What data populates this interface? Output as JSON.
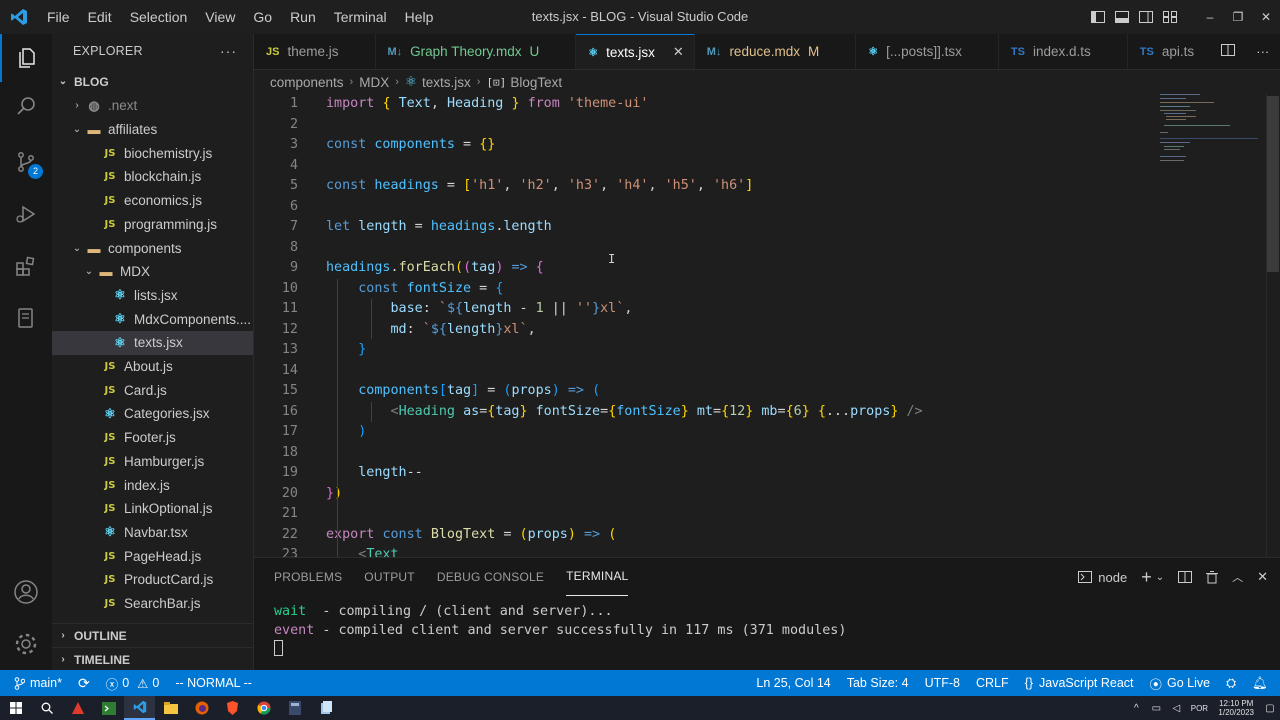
{
  "titlebar": {
    "menu": [
      "File",
      "Edit",
      "Selection",
      "View",
      "Go",
      "Run",
      "Terminal",
      "Help"
    ],
    "window_title": "texts.jsx - BLOG - Visual Studio Code"
  },
  "activity": {
    "source_control_badge": "2"
  },
  "explorer": {
    "header": "EXPLORER",
    "more": "···",
    "root": "BLOG",
    "rows": [
      {
        "label": ".next",
        "kind": "folder-next",
        "depth": 1,
        "chev": "›",
        "dim": true
      },
      {
        "label": "affiliates",
        "kind": "folder",
        "depth": 1,
        "chev": "⌄"
      },
      {
        "label": "biochemistry.js",
        "kind": "js",
        "depth": 2
      },
      {
        "label": "blockchain.js",
        "kind": "js",
        "depth": 2
      },
      {
        "label": "economics.js",
        "kind": "js",
        "depth": 2
      },
      {
        "label": "programming.js",
        "kind": "js",
        "depth": 2
      },
      {
        "label": "components",
        "kind": "folder",
        "depth": 1,
        "chev": "⌄"
      },
      {
        "label": "MDX",
        "kind": "folder",
        "depth": 2,
        "chev": "⌄"
      },
      {
        "label": "lists.jsx",
        "kind": "react",
        "depth": 3
      },
      {
        "label": "MdxComponents....",
        "kind": "react",
        "depth": 3
      },
      {
        "label": "texts.jsx",
        "kind": "react",
        "depth": 3,
        "selected": true
      },
      {
        "label": "About.js",
        "kind": "js",
        "depth": 2
      },
      {
        "label": "Card.js",
        "kind": "js",
        "depth": 2
      },
      {
        "label": "Categories.jsx",
        "kind": "react",
        "depth": 2
      },
      {
        "label": "Footer.js",
        "kind": "js",
        "depth": 2
      },
      {
        "label": "Hamburger.js",
        "kind": "js",
        "depth": 2
      },
      {
        "label": "index.js",
        "kind": "js",
        "depth": 2
      },
      {
        "label": "LinkOptional.js",
        "kind": "js",
        "depth": 2
      },
      {
        "label": "Navbar.tsx",
        "kind": "react",
        "depth": 2
      },
      {
        "label": "PageHead.js",
        "kind": "js",
        "depth": 2
      },
      {
        "label": "ProductCard.js",
        "kind": "js",
        "depth": 2
      },
      {
        "label": "SearchBar.js",
        "kind": "js",
        "depth": 2
      }
    ],
    "outline": "OUTLINE",
    "timeline": "TIMELINE"
  },
  "tabs": [
    {
      "label": "theme.js",
      "icon": "JS",
      "kind": "js"
    },
    {
      "label": "Graph Theory.mdx",
      "icon": "M↓",
      "kind": "mdx",
      "mod": "U",
      "mod_color": "#73c991"
    },
    {
      "label": "texts.jsx",
      "icon": "⚛",
      "kind": "react",
      "active": true,
      "close": "✕"
    },
    {
      "label": "reduce.mdx",
      "icon": "M↓",
      "kind": "mdx",
      "mod": "M",
      "mod_color": "#e2c08d"
    },
    {
      "label": "[...posts]].tsx",
      "icon": "⚛",
      "kind": "react"
    },
    {
      "label": "index.d.ts",
      "icon": "TS",
      "kind": "ts"
    },
    {
      "label": "api.ts",
      "icon": "TS",
      "kind": "ts"
    }
  ],
  "breadcrumb": {
    "items": [
      "components",
      "MDX",
      "texts.jsx",
      "BlogText"
    ]
  },
  "code": {
    "lines": [
      [
        [
          "kw-ctl",
          "import"
        ],
        [
          "pun",
          " "
        ],
        [
          "br1",
          "{"
        ],
        [
          "pun",
          " "
        ],
        [
          "var",
          "Text"
        ],
        [
          "pun",
          ", "
        ],
        [
          "var",
          "Heading"
        ],
        [
          "pun",
          " "
        ],
        [
          "br1",
          "}"
        ],
        [
          "pun",
          " "
        ],
        [
          "ctl",
          "from"
        ],
        [
          "pun",
          " "
        ],
        [
          "str",
          "'theme-ui'"
        ]
      ],
      [],
      [
        [
          "kw",
          "const"
        ],
        [
          "pun",
          " "
        ],
        [
          "const",
          "components"
        ],
        [
          "pun",
          " = "
        ],
        [
          "br1",
          "{}"
        ]
      ],
      [],
      [
        [
          "kw",
          "const"
        ],
        [
          "pun",
          " "
        ],
        [
          "const",
          "headings"
        ],
        [
          "pun",
          " = "
        ],
        [
          "br1",
          "["
        ],
        [
          "str",
          "'h1'"
        ],
        [
          "pun",
          ", "
        ],
        [
          "str",
          "'h2'"
        ],
        [
          "pun",
          ", "
        ],
        [
          "str",
          "'h3'"
        ],
        [
          "pun",
          ", "
        ],
        [
          "str",
          "'h4'"
        ],
        [
          "pun",
          ", "
        ],
        [
          "str",
          "'h5'"
        ],
        [
          "pun",
          ", "
        ],
        [
          "str",
          "'h6'"
        ],
        [
          "br1",
          "]"
        ]
      ],
      [],
      [
        [
          "kw",
          "let"
        ],
        [
          "pun",
          " "
        ],
        [
          "var",
          "length"
        ],
        [
          "pun",
          " = "
        ],
        [
          "const",
          "headings"
        ],
        [
          "pun",
          "."
        ],
        [
          "var",
          "length"
        ]
      ],
      [],
      [
        [
          "const",
          "headings"
        ],
        [
          "pun",
          "."
        ],
        [
          "fn",
          "forEach"
        ],
        [
          "br1",
          "("
        ],
        [
          "br2",
          "("
        ],
        [
          "var",
          "tag"
        ],
        [
          "br2",
          ")"
        ],
        [
          "pun",
          " "
        ],
        [
          "kw",
          "=>"
        ],
        [
          "pun",
          " "
        ],
        [
          "br2",
          "{"
        ]
      ],
      [
        [
          "pun",
          "    "
        ],
        [
          "kw",
          "const"
        ],
        [
          "pun",
          " "
        ],
        [
          "const",
          "fontSize"
        ],
        [
          "pun",
          " = "
        ],
        [
          "br3",
          "{"
        ]
      ],
      [
        [
          "pun",
          "        "
        ],
        [
          "var",
          "base"
        ],
        [
          "pun",
          ": "
        ],
        [
          "str",
          "`"
        ],
        [
          "kw",
          "${"
        ],
        [
          "var",
          "length"
        ],
        [
          "pun",
          " - "
        ],
        [
          "num",
          "1"
        ],
        [
          "pun",
          " || "
        ],
        [
          "str",
          "''"
        ],
        [
          "kw",
          "}"
        ],
        [
          "str",
          "xl`"
        ],
        [
          "pun",
          ","
        ]
      ],
      [
        [
          "pun",
          "        "
        ],
        [
          "var",
          "md"
        ],
        [
          "pun",
          ": "
        ],
        [
          "str",
          "`"
        ],
        [
          "kw",
          "${"
        ],
        [
          "var",
          "length"
        ],
        [
          "kw",
          "}"
        ],
        [
          "str",
          "xl`"
        ],
        [
          "pun",
          ","
        ]
      ],
      [
        [
          "pun",
          "    "
        ],
        [
          "br3",
          "}"
        ]
      ],
      [],
      [
        [
          "pun",
          "    "
        ],
        [
          "const",
          "components"
        ],
        [
          "br3",
          "["
        ],
        [
          "var",
          "tag"
        ],
        [
          "br3",
          "]"
        ],
        [
          "pun",
          " = "
        ],
        [
          "br3",
          "("
        ],
        [
          "var",
          "props"
        ],
        [
          "br3",
          ")"
        ],
        [
          "pun",
          " "
        ],
        [
          "kw",
          "=>"
        ],
        [
          "pun",
          " "
        ],
        [
          "br3",
          "("
        ]
      ],
      [
        [
          "pun",
          "        "
        ],
        [
          "angle",
          "<"
        ],
        [
          "tag",
          "Heading"
        ],
        [
          "pun",
          " "
        ],
        [
          "var",
          "as"
        ],
        [
          "pun",
          "="
        ],
        [
          "br1",
          "{"
        ],
        [
          "var",
          "tag"
        ],
        [
          "br1",
          "}"
        ],
        [
          "pun",
          " "
        ],
        [
          "var",
          "fontSize"
        ],
        [
          "pun",
          "="
        ],
        [
          "br1",
          "{"
        ],
        [
          "const",
          "fontSize"
        ],
        [
          "br1",
          "}"
        ],
        [
          "pun",
          " "
        ],
        [
          "var",
          "mt"
        ],
        [
          "pun",
          "="
        ],
        [
          "br1",
          "{"
        ],
        [
          "num",
          "12"
        ],
        [
          "br1",
          "}"
        ],
        [
          "pun",
          " "
        ],
        [
          "var",
          "mb"
        ],
        [
          "pun",
          "="
        ],
        [
          "br1",
          "{"
        ],
        [
          "num",
          "6"
        ],
        [
          "br1",
          "}"
        ],
        [
          "pun",
          " "
        ],
        [
          "br1",
          "{"
        ],
        [
          "pun",
          "..."
        ],
        [
          "var",
          "props"
        ],
        [
          "br1",
          "}"
        ],
        [
          "pun",
          " "
        ],
        [
          "angle",
          "/>"
        ]
      ],
      [
        [
          "pun",
          "    "
        ],
        [
          "br3",
          ")"
        ]
      ],
      [],
      [
        [
          "pun",
          "    "
        ],
        [
          "var",
          "length"
        ],
        [
          "pun",
          "--"
        ]
      ],
      [
        [
          "br2",
          "}"
        ],
        [
          "br1",
          ")"
        ]
      ],
      [],
      [
        [
          "ctl",
          "export"
        ],
        [
          "pun",
          " "
        ],
        [
          "kw",
          "const"
        ],
        [
          "pun",
          " "
        ],
        [
          "fn",
          "BlogText"
        ],
        [
          "pun",
          " = "
        ],
        [
          "br1",
          "("
        ],
        [
          "var",
          "props"
        ],
        [
          "br1",
          ")"
        ],
        [
          "pun",
          " "
        ],
        [
          "kw",
          "=>"
        ],
        [
          "pun",
          " "
        ],
        [
          "br1",
          "("
        ]
      ],
      [
        [
          "pun",
          "    "
        ],
        [
          "angle",
          "<"
        ],
        [
          "tag",
          "Text"
        ]
      ]
    ]
  },
  "panel": {
    "tabs": [
      "PROBLEMS",
      "OUTPUT",
      "DEBUG CONSOLE",
      "TERMINAL"
    ],
    "active_tab": "TERMINAL",
    "shell": "node",
    "terminal": [
      {
        "tag": "wait",
        "text": "  - compiling / (client and server)..."
      },
      {
        "tag": "event",
        "text": " - compiled client and server successfully in 117 ms (371 modules)"
      }
    ]
  },
  "status": {
    "branch": "main*",
    "errors": "0",
    "warnings": "0",
    "mode": "-- NORMAL --",
    "position": "Ln 25, Col 14",
    "tab_size": "Tab Size: 4",
    "encoding": "UTF-8",
    "eol": "CRLF",
    "language": "JavaScript React",
    "live": "Go Live"
  },
  "taskbar": {
    "lang": "POR",
    "time": "12:10 PM",
    "date": "1/20/2023"
  },
  "colors": {
    "accent": "#0078d4",
    "statusbar": "#0078d4",
    "editor_bg": "#1e1e1e"
  }
}
